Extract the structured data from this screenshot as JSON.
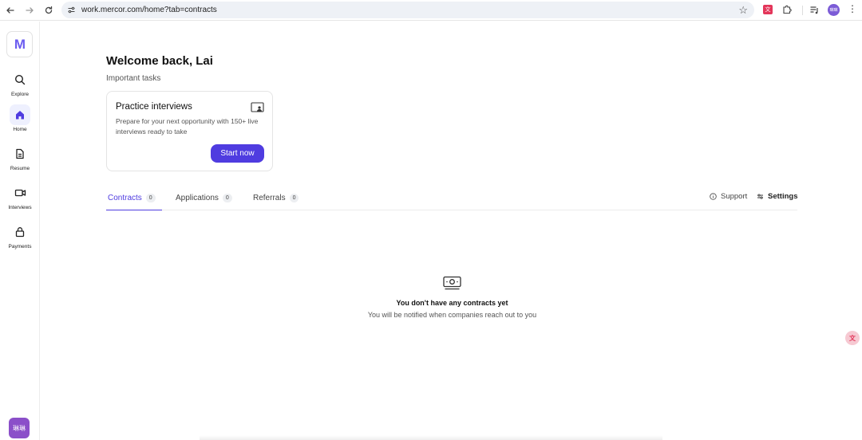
{
  "browser": {
    "url": "work.mercor.com/home?tab=contracts",
    "translate_ext_label": "文",
    "profile_initials": "琳琳"
  },
  "sidebar": {
    "logo": "M",
    "items": [
      {
        "label": "Explore",
        "icon": "search-icon"
      },
      {
        "label": "Home",
        "icon": "home-icon"
      },
      {
        "label": "Resume",
        "icon": "document-icon"
      },
      {
        "label": "Interviews",
        "icon": "video-icon"
      },
      {
        "label": "Payments",
        "icon": "lock-icon"
      }
    ],
    "user_initials": "琳琳"
  },
  "main": {
    "welcome": "Welcome back, Lai",
    "important_tasks": "Important tasks",
    "card": {
      "title": "Practice interviews",
      "description": "Prepare for your next opportunity with 150+ live interviews ready to take",
      "button": "Start now"
    },
    "tabs": [
      {
        "label": "Contracts",
        "count": "0"
      },
      {
        "label": "Applications",
        "count": "0"
      },
      {
        "label": "Referrals",
        "count": "0"
      }
    ],
    "support": "Support",
    "settings": "Settings",
    "empty": {
      "title": "You don't have any contracts yet",
      "subtitle": "You will be notified when companies reach out to you"
    }
  },
  "colors": {
    "accent": "#4f3ce0",
    "logo": "#6b5cf0",
    "avatar": "#8b4fc9"
  }
}
